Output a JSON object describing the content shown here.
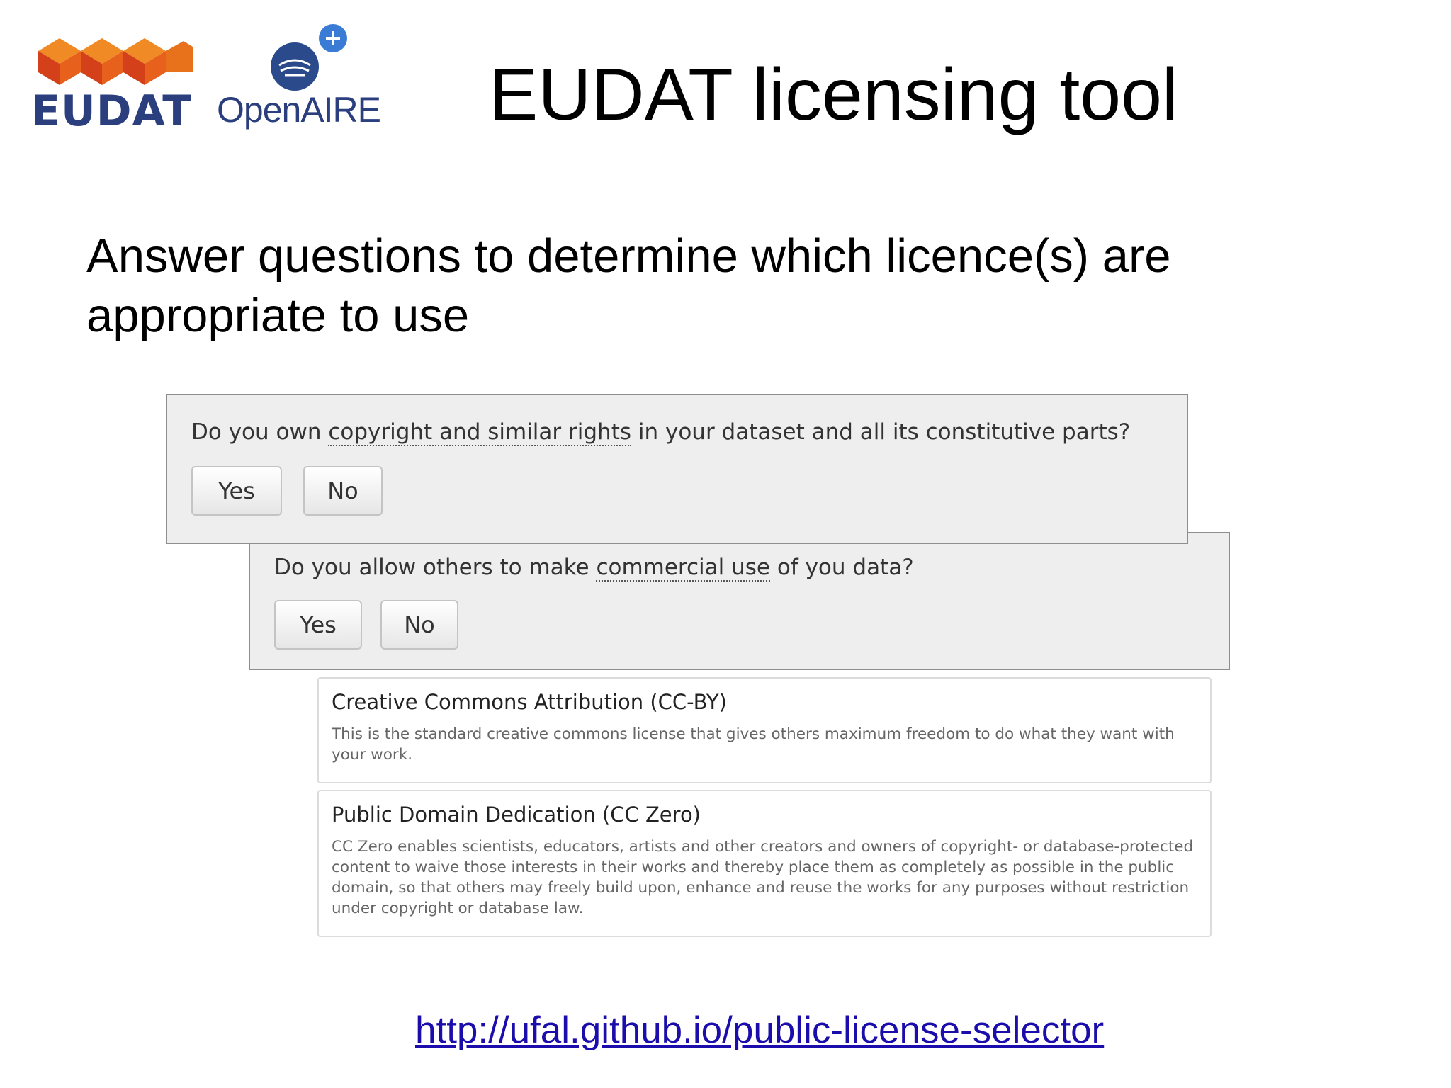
{
  "logos": {
    "eudat": {
      "text": "EUDAT",
      "colors": {
        "orange": "#e8711c",
        "red": "#d4401a",
        "navy": "#2b3f7e"
      }
    },
    "openaire": {
      "text": "OpenAIRE",
      "color": "#2b3f7e"
    }
  },
  "title": "EUDAT licensing tool",
  "subtitle": "Answer questions to determine which licence(s) are appropriate to use",
  "questions": [
    {
      "prefix": "Do you own ",
      "term": "copyright and similar rights",
      "suffix": " in your dataset and all its constitutive parts?",
      "yes_label": "Yes",
      "no_label": "No"
    },
    {
      "prefix": "Do you allow others to make ",
      "term": "commercial use",
      "suffix": " of you data?",
      "yes_label": "Yes",
      "no_label": "No"
    }
  ],
  "licenses": [
    {
      "title": "Creative Commons Attribution (CC-BY)",
      "description": "This is the standard creative commons license that gives others maximum freedom to do what they want with your work."
    },
    {
      "title": "Public Domain Dedication (CC Zero)",
      "description": "CC Zero enables scientists, educators, artists and other creators and owners of copyright- or database-protected content to waive those interests in their works and thereby place them as completely as possible in the public domain, so that others may freely build upon, enhance and reuse the works for any purposes without restriction under copyright or database law."
    }
  ],
  "link": "http://ufal.github.io/public-license-selector"
}
